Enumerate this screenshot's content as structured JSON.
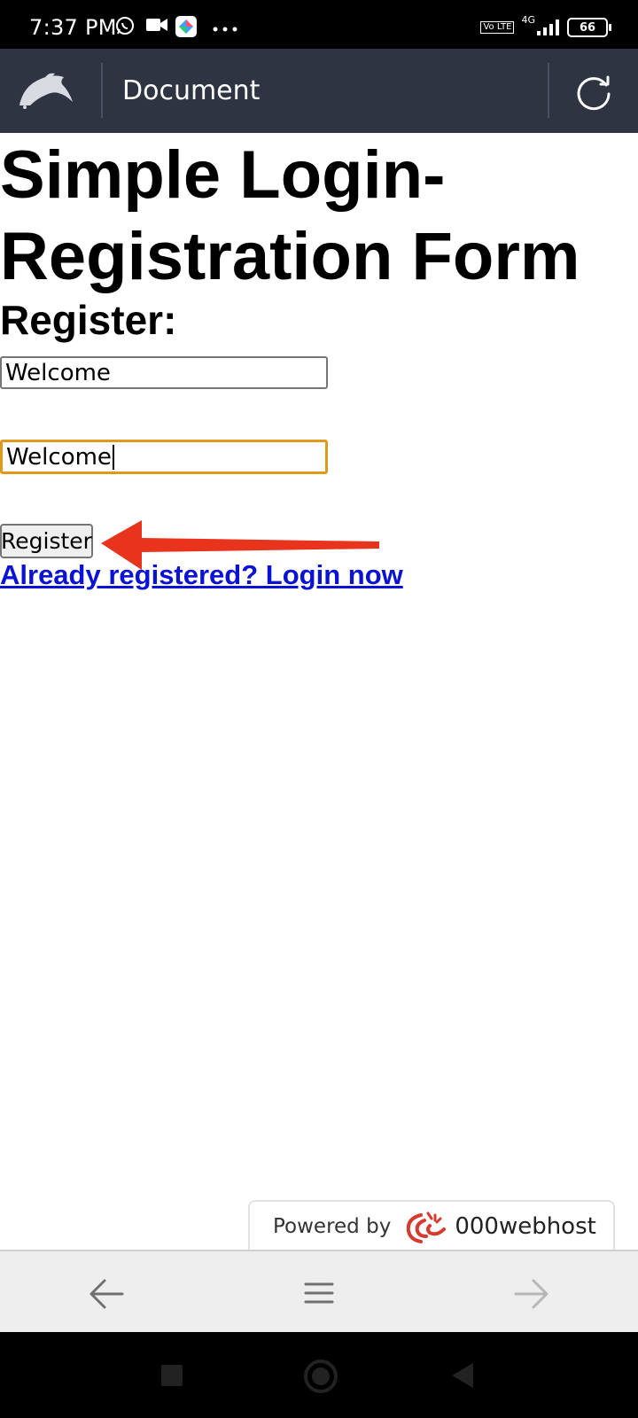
{
  "status_bar": {
    "time": "7:37 PM",
    "volte_label": "Vo LTE",
    "network": "4G",
    "battery": "66"
  },
  "app_bar": {
    "title": "Document"
  },
  "page": {
    "heading": "Simple Login-Registration Form",
    "subheading": "Register:",
    "field1_value": "Welcome",
    "field2_value": "Welcome",
    "register_button": "Register",
    "login_link": "Already registered? Login now"
  },
  "footer_tab": {
    "powered_by": "Powered by",
    "brand": "000webhost"
  },
  "colors": {
    "app_bar_bg": "#2e3442",
    "focus_border": "#e09a1a",
    "link": "#0a12d6",
    "annotation_arrow": "#e8341c"
  }
}
